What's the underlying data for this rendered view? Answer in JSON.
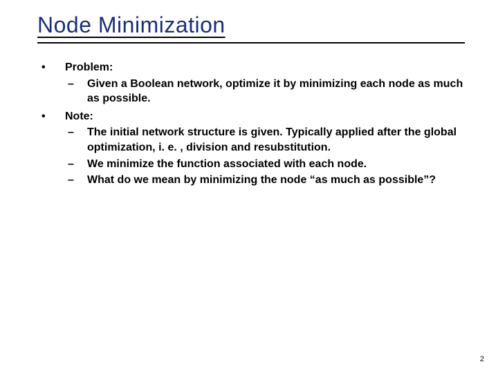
{
  "title": "Node Minimization",
  "bullets": [
    {
      "label": "Problem:",
      "subs": [
        "Given a Boolean network, optimize it by minimizing each node as much as possible."
      ]
    },
    {
      "label": "Note:",
      "subs": [
        "The initial network structure is given. Typically applied after the global optimization, i. e. , division and resubstitution.",
        "We minimize the function associated with each node.",
        "What do we mean by minimizing the node “as much as possible”?"
      ]
    }
  ],
  "page_number": "2"
}
